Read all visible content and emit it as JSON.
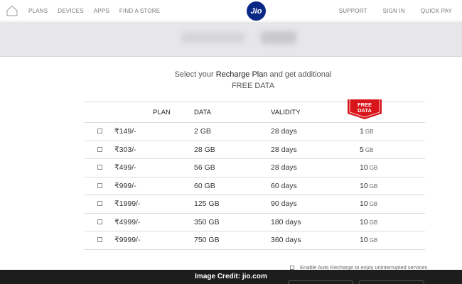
{
  "nav": {
    "left": [
      "PLANS",
      "DEVICES",
      "APPS",
      "FIND A STORE"
    ],
    "brand": "Jio",
    "right": [
      "SUPPORT",
      "SIGN IN",
      "QUICK PAY"
    ]
  },
  "headline": {
    "line1_pre": "Select your ",
    "line1_bold": "Recharge Plan",
    "line1_post": " and get additional",
    "line2": "FREE DATA"
  },
  "table": {
    "headers": {
      "plan": "PLAN",
      "data": "DATA",
      "validity": "VALIDITY",
      "free_data": [
        "FREE",
        "DATA"
      ]
    },
    "rows": [
      {
        "plan": "₹149/-",
        "data": "2 GB",
        "validity": "28 days",
        "free": "1",
        "unit": "GB"
      },
      {
        "plan": "₹303/-",
        "data": "28 GB",
        "validity": "28 days",
        "free": "5",
        "unit": "GB"
      },
      {
        "plan": "₹499/-",
        "data": "56 GB",
        "validity": "28 days",
        "free": "10",
        "unit": "GB"
      },
      {
        "plan": "₹999/-",
        "data": "60 GB",
        "validity": "60 days",
        "free": "10",
        "unit": "GB"
      },
      {
        "plan": "₹1999/-",
        "data": "125 GB",
        "validity": "90 days",
        "free": "10",
        "unit": "GB"
      },
      {
        "plan": "₹4999/-",
        "data": "350 GB",
        "validity": "180 days",
        "free": "10",
        "unit": "GB"
      },
      {
        "plan": "₹9999/-",
        "data": "750 GB",
        "validity": "360 days",
        "free": "10",
        "unit": "GB"
      }
    ]
  },
  "auto_recharge": "Enable Auto Recharge to enjoy uninterrupted services",
  "credit": "Image Credit: jio.com",
  "colors": {
    "brand": "#0a2885",
    "badge": "#d9151c",
    "band": "#e7e7e9",
    "credit_bar": "#1d1d1d"
  },
  "icons": [
    "home-icon",
    "checkbox-icon"
  ]
}
